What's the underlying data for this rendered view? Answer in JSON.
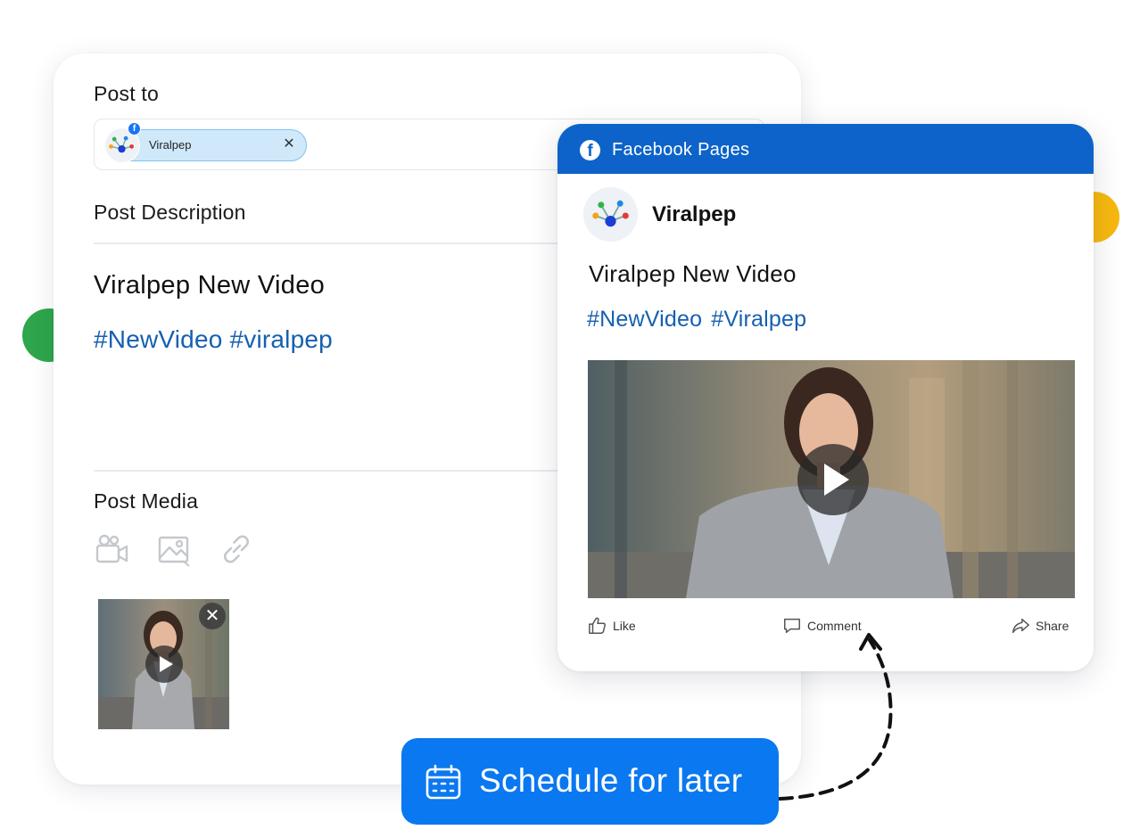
{
  "composer": {
    "post_to_label": "Post to",
    "chip": {
      "account_name": "Viralpep",
      "remove_glyph": "✕",
      "network_badge": "f"
    },
    "post_description_label": "Post Description",
    "description": {
      "title": "Viralpep New Video",
      "hashtags": "#NewVideo #viralpep"
    },
    "post_media_label": "Post Media",
    "media_icons": [
      "video-camera-icon",
      "image-icon",
      "link-icon"
    ],
    "thumbnail": {
      "remove_glyph": "✕",
      "overlay": "play-icon"
    }
  },
  "preview": {
    "header_title": "Facebook Pages",
    "header_badge": "f",
    "page_name": "Viralpep",
    "post_title": "Viralpep New Video",
    "hashtags": [
      "#NewVideo",
      "#Viralpep"
    ],
    "actions": {
      "like": "Like",
      "comment": "Comment",
      "share": "Share"
    }
  },
  "schedule_button": {
    "label": "Schedule for later"
  },
  "colors": {
    "brand_blue": "#0a78f0",
    "facebook_header": "#0d63c9",
    "hashtag": "#1560b0",
    "chip_bg": "#cfe9fb",
    "green_dot": "#2ea64c",
    "yellow_dot": "#f7b90f"
  }
}
